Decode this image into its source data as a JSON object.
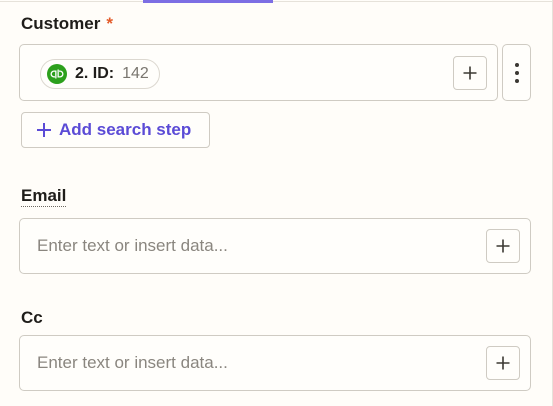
{
  "customer": {
    "label": "Customer",
    "required_mark": "*",
    "chip": {
      "icon": "quickbooks-logo-icon",
      "key": "2. ID:",
      "value": "142"
    }
  },
  "add_search_step": {
    "label": "Add search step"
  },
  "email": {
    "label": "Email",
    "placeholder": "Enter text or insert data..."
  },
  "cc": {
    "label": "Cc",
    "placeholder": "Enter text or insert data..."
  },
  "colors": {
    "accent": "#7c6ee4",
    "link": "#5b4bd6",
    "required": "#e35b2a",
    "quickbooks": "#2ca01c"
  }
}
